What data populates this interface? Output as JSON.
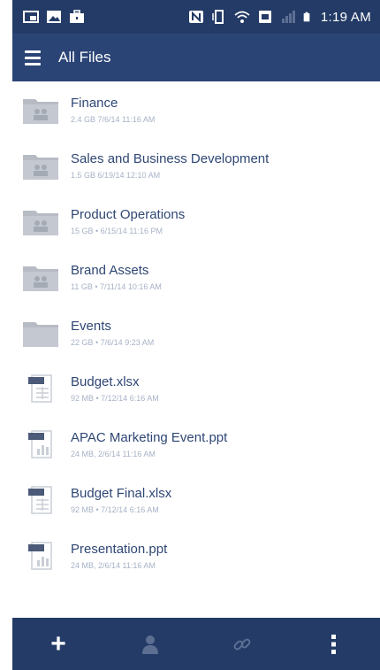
{
  "status_bar": {
    "time": "1:19 AM",
    "icons": [
      "screenshot-icon",
      "gallery-icon",
      "briefcase-icon",
      "nfc-icon",
      "vibrate-icon",
      "wifi-icon",
      "sim-icon",
      "signal-icon",
      "battery-icon"
    ]
  },
  "app_bar": {
    "title": "All Files",
    "menu_icon": "hamburger-menu-icon"
  },
  "files": [
    {
      "name": "Finance",
      "meta": "2.4 GB 7/6/14 11:16 AM",
      "icon": "shared-folder-icon"
    },
    {
      "name": "Sales and Business Development",
      "meta": "1.5 GB 6/19/14 12:10 AM",
      "icon": "shared-folder-icon"
    },
    {
      "name": "Product Operations",
      "meta": "15 GB • 6/15/14 11:16 PM",
      "icon": "shared-folder-icon"
    },
    {
      "name": "Brand Assets",
      "meta": "11 GB • 7/11/14 10:16 AM",
      "icon": "shared-folder-icon"
    },
    {
      "name": "Events",
      "meta": "22 GB • 7/6/14 9:23 AM",
      "icon": "folder-icon"
    },
    {
      "name": "Budget.xlsx",
      "meta": "92 MB • 7/12/14 6:16 AM",
      "icon": "spreadsheet-file-icon"
    },
    {
      "name": "APAC Marketing Event.ppt",
      "meta": "24 MB, 2/6/14 11:16 AM",
      "icon": "presentation-file-icon"
    },
    {
      "name": "Budget Final.xlsx",
      "meta": "92 MB • 7/12/14 6:16 AM",
      "icon": "spreadsheet-file-icon"
    },
    {
      "name": "Presentation.ppt",
      "meta": "24 MB, 2/6/14 11:16 AM",
      "icon": "presentation-file-icon"
    }
  ],
  "bottom_bar": {
    "add_symbol": "+",
    "actions": [
      "add-icon",
      "person-icon",
      "link-icon",
      "more-vertical-icon"
    ]
  },
  "colors": {
    "status_bar": "#233b66",
    "app_bar": "#2b4476",
    "file_name": "#2f4774",
    "meta_text": "#a7b2c6",
    "bottom_bar": "#233b66",
    "folder": "#b7bcc4"
  }
}
